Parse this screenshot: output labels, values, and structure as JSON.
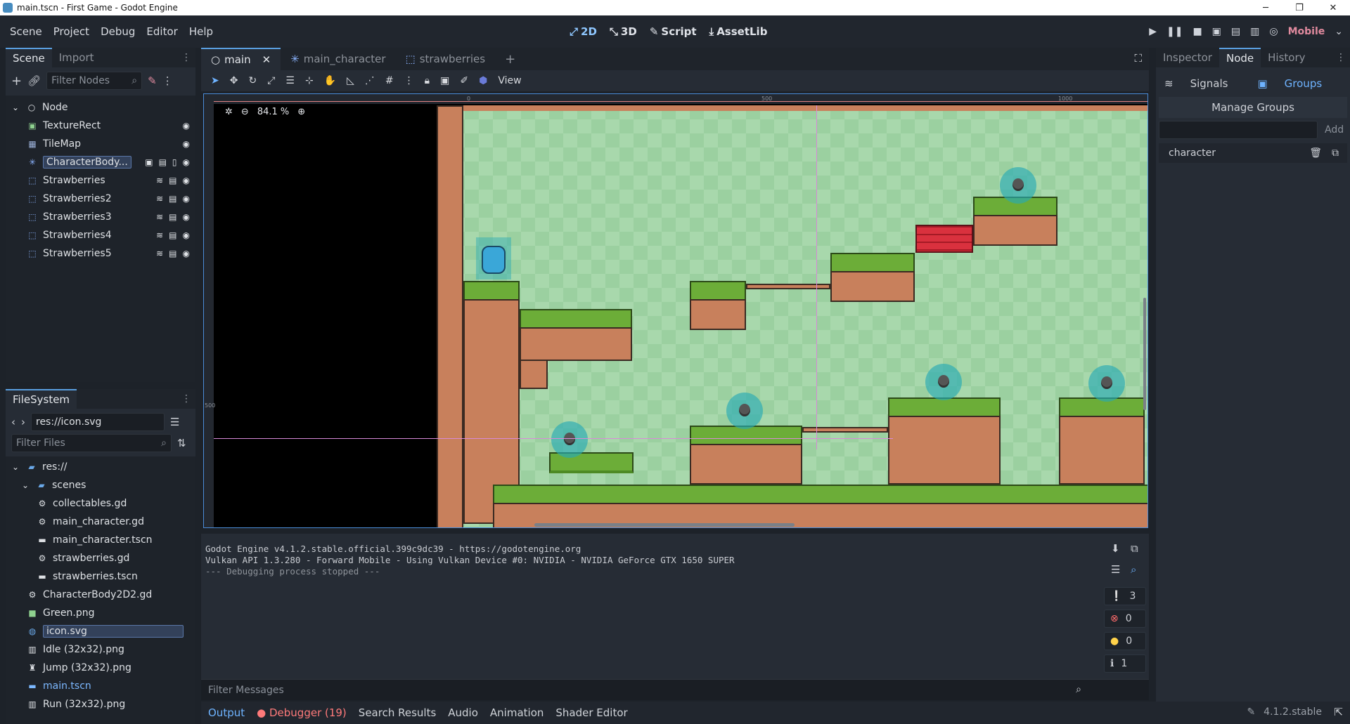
{
  "window": {
    "title": "main.tscn - First Game - Godot Engine"
  },
  "menu": [
    "Scene",
    "Project",
    "Debug",
    "Editor",
    "Help"
  ],
  "workspaces": [
    "2D",
    "3D",
    "Script",
    "AssetLib"
  ],
  "renderer": "Mobile",
  "scene_dock": {
    "tabs": [
      "Scene",
      "Import"
    ],
    "filter_placeholder": "Filter Nodes",
    "nodes": [
      {
        "label": "Node",
        "icon": "node-icon"
      },
      {
        "label": "TextureRect",
        "icon": "texture-rect-icon"
      },
      {
        "label": "TileMap",
        "icon": "tilemap-icon"
      },
      {
        "label": "CharacterBody...",
        "icon": "character-body-icon"
      },
      {
        "label": "Strawberries",
        "icon": "area-icon"
      },
      {
        "label": "Strawberries2",
        "icon": "area-icon"
      },
      {
        "label": "Strawberries3",
        "icon": "area-icon"
      },
      {
        "label": "Strawberries4",
        "icon": "area-icon"
      },
      {
        "label": "Strawberries5",
        "icon": "area-icon"
      }
    ]
  },
  "filesystem": {
    "title": "FileSystem",
    "path": "res://icon.svg",
    "filter_placeholder": "Filter Files",
    "items": [
      {
        "label": "res://",
        "icon": "folder-icon"
      },
      {
        "label": "scenes",
        "icon": "folder-icon"
      },
      {
        "label": "collectables.gd",
        "icon": "gear-icon"
      },
      {
        "label": "main_character.gd",
        "icon": "gear-icon"
      },
      {
        "label": "main_character.tscn",
        "icon": "scene-icon"
      },
      {
        "label": "strawberries.gd",
        "icon": "gear-icon"
      },
      {
        "label": "strawberries.tscn",
        "icon": "scene-icon"
      },
      {
        "label": "CharacterBody2D2.gd",
        "icon": "gear-icon"
      },
      {
        "label": "Green.png",
        "icon": "image-icon"
      },
      {
        "label": "icon.svg",
        "icon": "image-icon"
      },
      {
        "label": "Idle (32x32).png",
        "icon": "image-icon"
      },
      {
        "label": "Jump (32x32).png",
        "icon": "image-icon"
      },
      {
        "label": "main.tscn",
        "icon": "scene-icon"
      },
      {
        "label": "Run (32x32).png",
        "icon": "image-icon"
      }
    ]
  },
  "editor_tabs": [
    "main",
    "main_character",
    "strawberries"
  ],
  "view_menu": "View",
  "zoom": "84.1 %",
  "ruler": [
    "0",
    "500",
    "1000"
  ],
  "ruler_side": "500",
  "console": {
    "lines": [
      "Godot Engine v4.1.2.stable.official.399c9dc39 - https://godotengine.org",
      "Vulkan API 1.3.280 - Forward Mobile - Using Vulkan Device #0: NVIDIA - NVIDIA GeForce GTX 1650 SUPER",
      "",
      "--- Debugging process stopped ---"
    ],
    "filter_placeholder": "Filter Messages",
    "counts": {
      "messages": "3",
      "errors": "0",
      "warnings": "0",
      "info": "1"
    }
  },
  "bottom_tabs": [
    "Output",
    "Debugger (19)",
    "Search Results",
    "Audio",
    "Animation",
    "Shader Editor"
  ],
  "version": "4.1.2.stable",
  "inspector": {
    "tabs": [
      "Inspector",
      "Node",
      "History"
    ],
    "subtabs": [
      "Signals",
      "Groups"
    ],
    "manage": "Manage Groups",
    "add_label": "Add",
    "groups": [
      "character"
    ]
  }
}
